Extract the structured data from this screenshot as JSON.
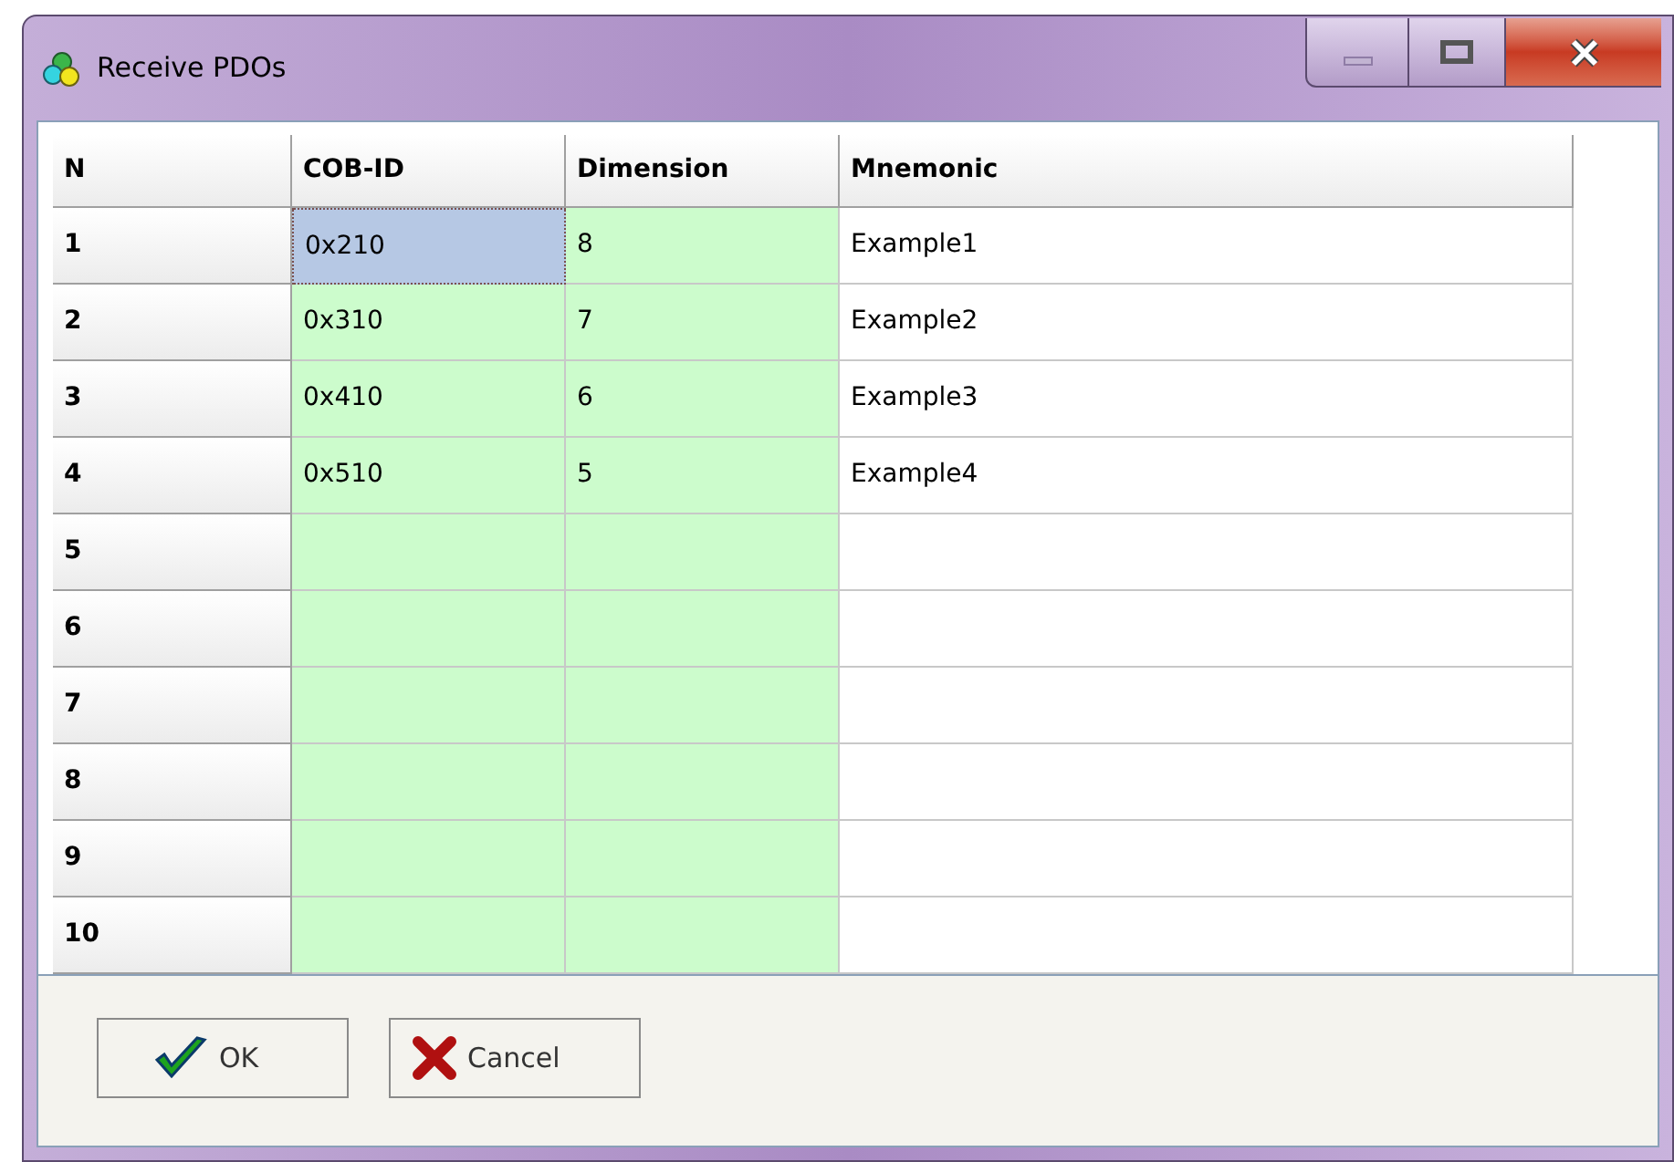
{
  "window": {
    "title": "Receive PDOs"
  },
  "table": {
    "columns": [
      "N",
      "COB-ID",
      "Dimension",
      "Mnemonic"
    ],
    "rows": [
      {
        "n": "1",
        "cob_id": "0x210",
        "dimension": "8",
        "mnemonic": "Example1",
        "selected": true
      },
      {
        "n": "2",
        "cob_id": "0x310",
        "dimension": "7",
        "mnemonic": "Example2",
        "selected": false
      },
      {
        "n": "3",
        "cob_id": "0x410",
        "dimension": "6",
        "mnemonic": "Example3",
        "selected": false
      },
      {
        "n": "4",
        "cob_id": "0x510",
        "dimension": "5",
        "mnemonic": "Example4",
        "selected": false
      },
      {
        "n": "5",
        "selected": false
      },
      {
        "n": "6",
        "selected": false
      },
      {
        "n": "7",
        "selected": false
      },
      {
        "n": "8",
        "selected": false
      },
      {
        "n": "9",
        "selected": false
      },
      {
        "n": "10",
        "selected": false
      }
    ]
  },
  "buttons": [
    {
      "label": "OK",
      "kind": "ok"
    },
    {
      "label": "Cancel",
      "kind": "cancel"
    }
  ]
}
